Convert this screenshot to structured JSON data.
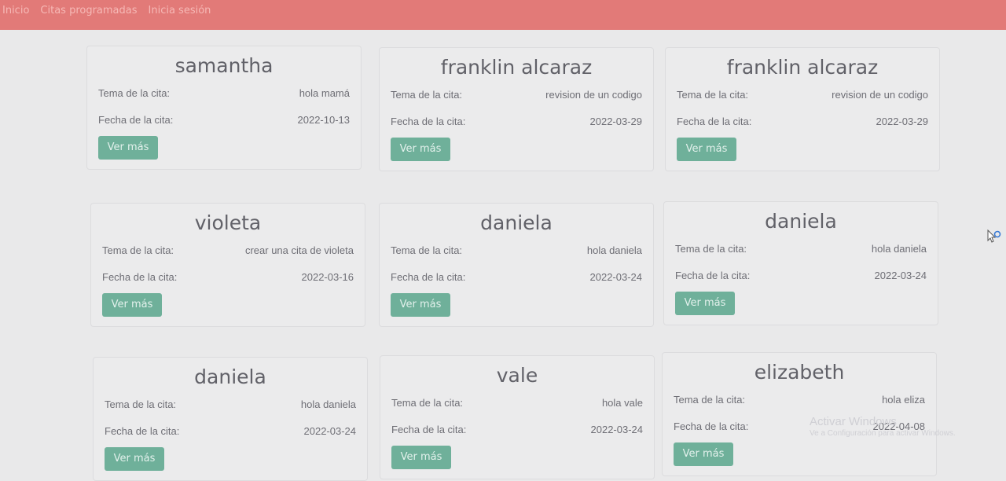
{
  "nav": {
    "items": [
      "Inicio",
      "Citas programadas",
      "Inicia sesión"
    ]
  },
  "labels": {
    "tema": "Tema de la cita:",
    "fecha": "Fecha de la cita:",
    "button": "Ver más"
  },
  "cards": [
    {
      "name": "samantha",
      "tema": "hola mamá",
      "fecha": "2022-10-13"
    },
    {
      "name": "franklin alcaraz",
      "tema": "revision de un codigo",
      "fecha": "2022-03-29"
    },
    {
      "name": "franklin alcaraz",
      "tema": "revision de un codigo",
      "fecha": "2022-03-29"
    },
    {
      "name": "violeta",
      "tema": "crear una cita de violeta",
      "fecha": "2022-03-16"
    },
    {
      "name": "daniela",
      "tema": "hola daniela",
      "fecha": "2022-03-24"
    },
    {
      "name": "daniela",
      "tema": "hola daniela",
      "fecha": "2022-03-24"
    },
    {
      "name": "daniela",
      "tema": "hola daniela",
      "fecha": "2022-03-24"
    },
    {
      "name": "vale",
      "tema": "hola vale",
      "fecha": "2022-03-24"
    },
    {
      "name": "elizabeth",
      "tema": "hola eliza",
      "fecha": "2022-04-08"
    }
  ],
  "watermark": {
    "line1": "Activar Windows",
    "line2": "Ve a Configuración para activar Windows."
  },
  "colors": {
    "navbar": "#e27a78",
    "button": "#6fb09a",
    "background": "#e9e9ea"
  }
}
